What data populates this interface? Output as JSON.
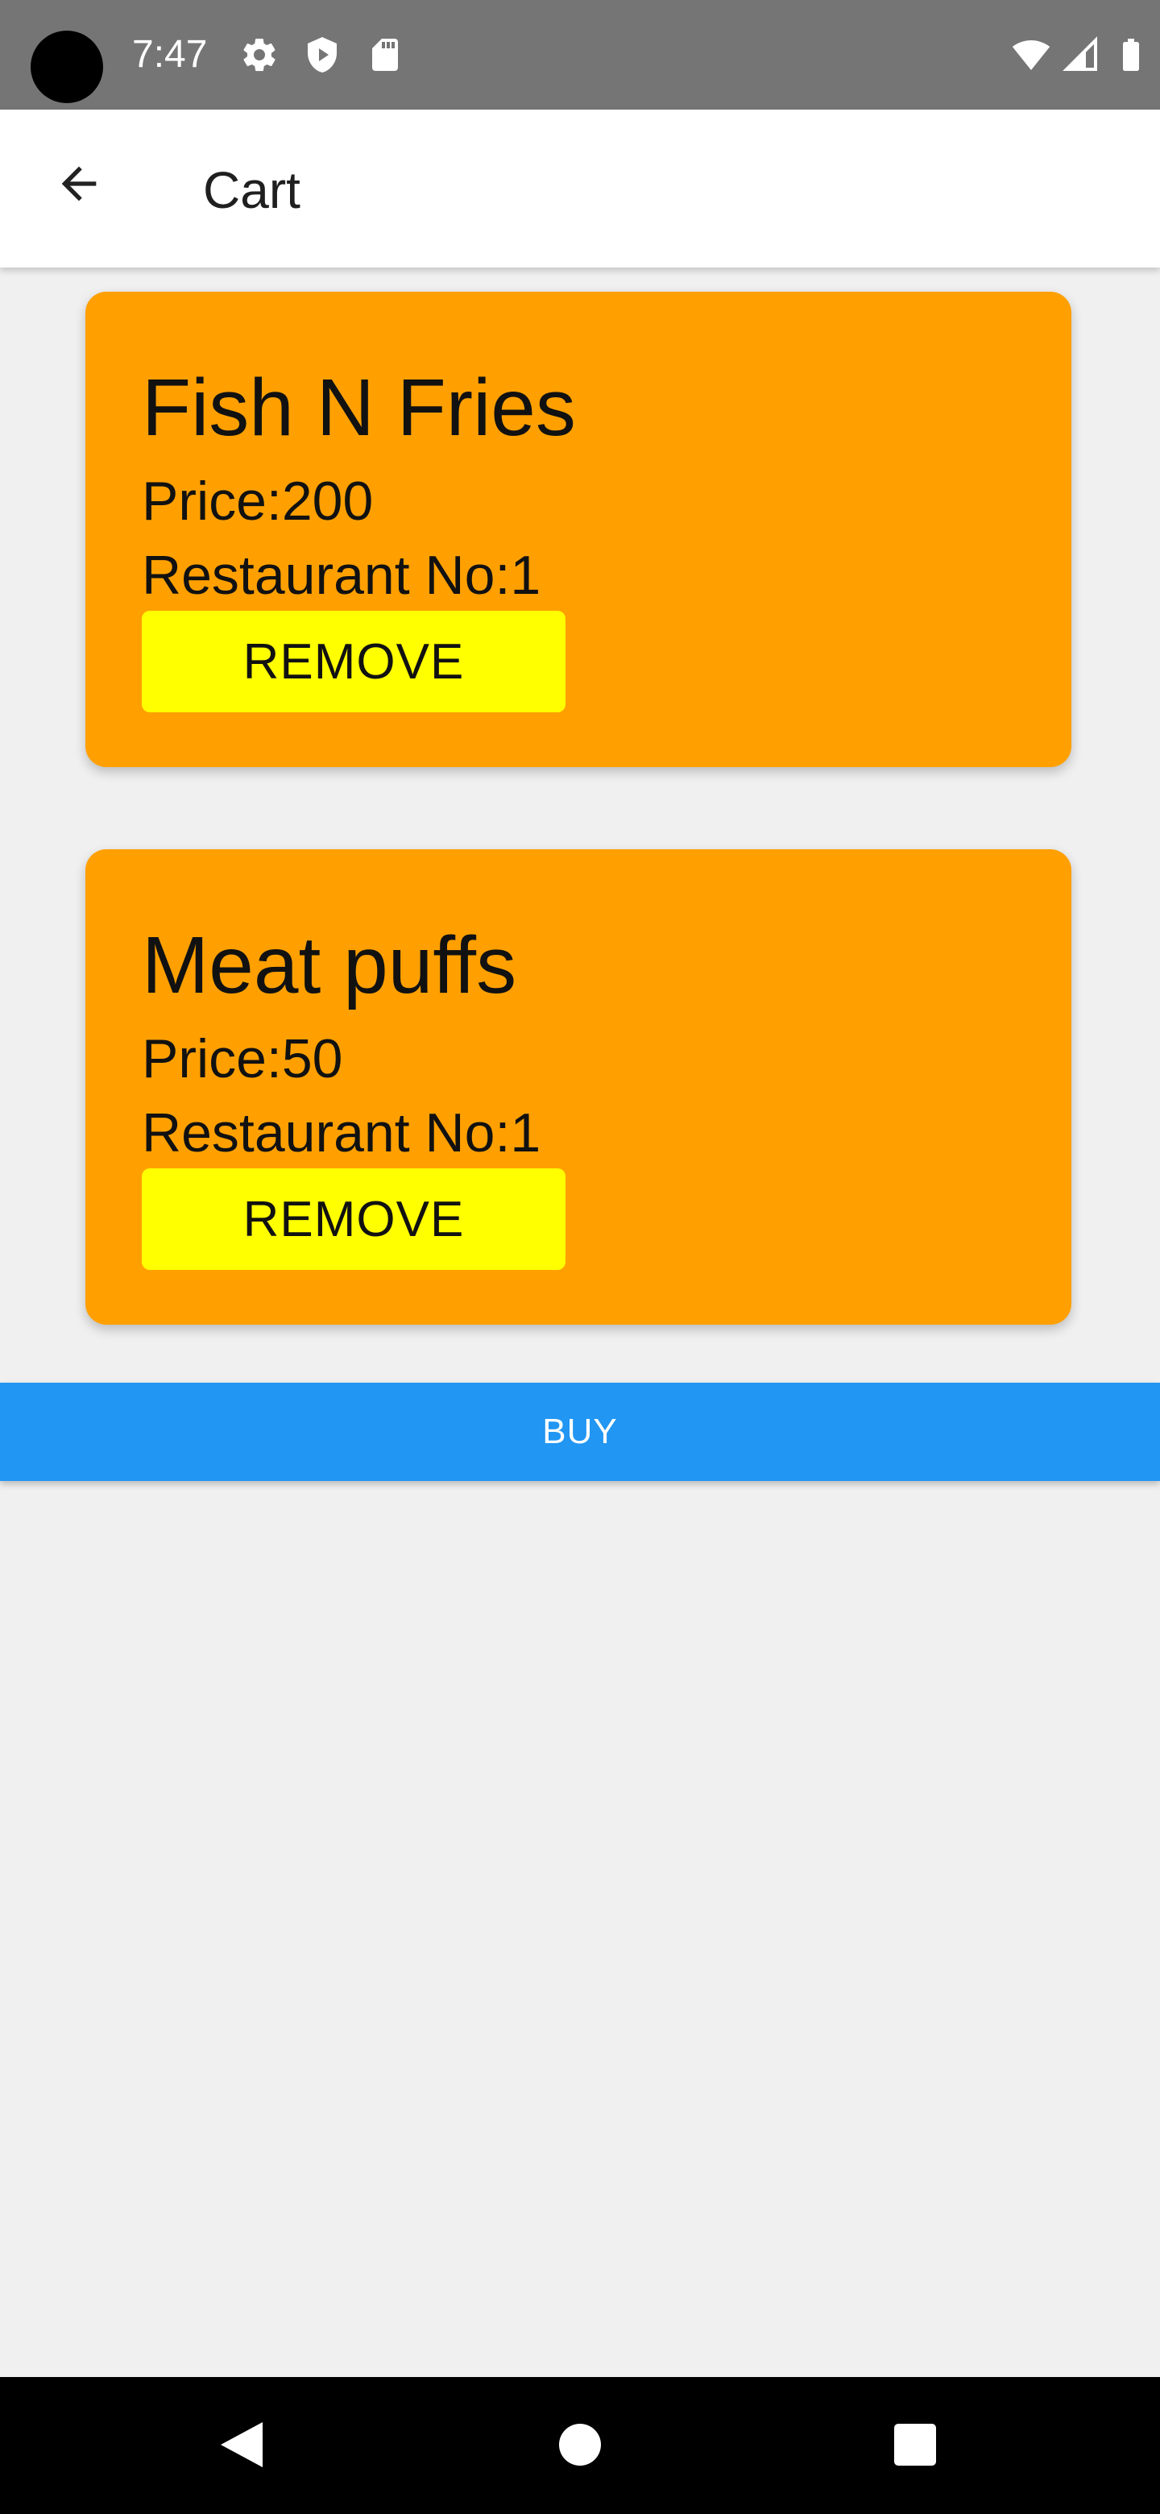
{
  "status_bar": {
    "time": "7:47",
    "icons": [
      "settings-icon",
      "shield-play-icon",
      "sd-card-icon",
      "wifi-icon",
      "signal-icon",
      "battery-icon"
    ]
  },
  "app_bar": {
    "title": "Cart",
    "back_icon": "arrow-back-icon"
  },
  "cart": {
    "items": [
      {
        "name": "Fish N Fries",
        "price_text": "Price:200",
        "restaurant_text": "Restaurant No:1",
        "remove_label": "REMOVE"
      },
      {
        "name": "Meat puffs",
        "price_text": "Price:50",
        "restaurant_text": "Restaurant No:1",
        "remove_label": "REMOVE"
      }
    ],
    "buy_label": "BUY"
  },
  "nav_bar": {
    "buttons": [
      "back-triangle-icon",
      "home-circle-icon",
      "recents-square-icon"
    ]
  },
  "colors": {
    "status_bar": "#757575",
    "card": "#ffa000",
    "remove_button": "#ffff00",
    "buy_button": "#2196f3",
    "background": "#f0f0f0"
  }
}
